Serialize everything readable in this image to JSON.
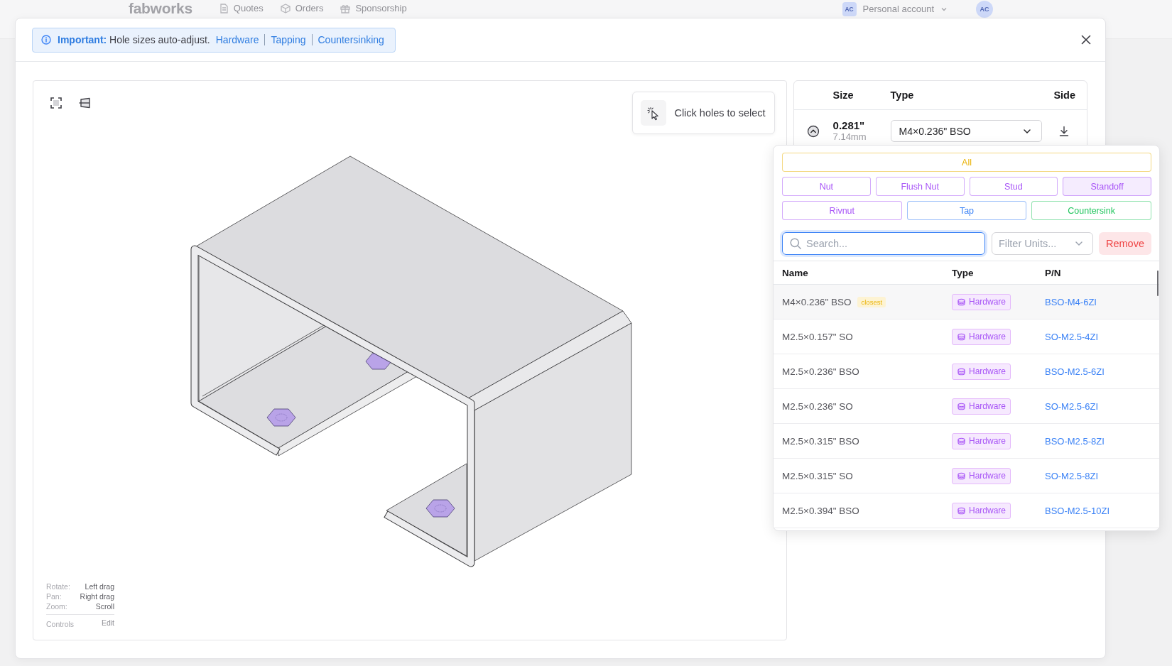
{
  "background_nav": {
    "logo": "fabworks",
    "links": [
      "Quotes",
      "Orders",
      "Sponsorship"
    ],
    "account_initials": "AC",
    "account": "Personal account",
    "avatar": "AC"
  },
  "notice": {
    "text": "**Important:** Hole sizes auto-adjust.",
    "links": [
      "Hardware",
      "Tapping",
      "Countersinking"
    ]
  },
  "viewer": {
    "hint": "Click holes to select",
    "controls": [
      {
        "action": "Rotate:",
        "input": "Left drag"
      },
      {
        "action": "Pan:",
        "input": "Right drag"
      },
      {
        "action": "Zoom:",
        "input": "Scroll"
      }
    ],
    "controls_label": "Controls",
    "edit_link": "Edit"
  },
  "holes_table": {
    "columns": [
      "Size",
      "Type",
      "Side"
    ],
    "rows": [
      {
        "size": "0.281\"",
        "size_mm": "7.14mm",
        "type": "M4×0.236\" BSO",
        "expanded": true
      }
    ]
  },
  "hardware_picker": {
    "filter_rows": [
      [
        {
          "label": "All",
          "color": "#eab308",
          "selected": false
        }
      ],
      [
        {
          "label": "Nut",
          "color": "#a855f7",
          "selected": false
        },
        {
          "label": "Flush Nut",
          "color": "#a855f7",
          "selected": false
        },
        {
          "label": "Stud",
          "color": "#a855f7",
          "selected": false
        },
        {
          "label": "Standoff",
          "color": "#a855f7",
          "selected": true
        }
      ],
      [
        {
          "label": "Rivnut",
          "color": "#a855f7",
          "selected": false
        },
        {
          "label": "Tap",
          "color": "#3b82f6",
          "selected": false
        },
        {
          "label": "Countersink",
          "color": "#22c55e",
          "selected": false
        }
      ]
    ],
    "search": {
      "placeholder": "Search..."
    },
    "unit_filter": {
      "placeholder": "Filter Units..."
    },
    "remove_button": "Remove",
    "columns": [
      "Name",
      "Type",
      "P/N"
    ],
    "rows": [
      {
        "name": "M4×0.236\" BSO",
        "tag": "closest",
        "type": "Hardware",
        "part_number": "BSO-M4-6ZI",
        "selected": true
      },
      {
        "name": "M2.5×0.157\" SO",
        "type": "Hardware",
        "part_number": "SO-M2.5-4ZI",
        "selected": false
      },
      {
        "name": "M2.5×0.236\" BSO",
        "type": "Hardware",
        "part_number": "BSO-M2.5-6ZI",
        "selected": false
      },
      {
        "name": "M2.5×0.236\" SO",
        "type": "Hardware",
        "part_number": "SO-M2.5-6ZI",
        "selected": false
      },
      {
        "name": "M2.5×0.315\" BSO",
        "type": "Hardware",
        "part_number": "BSO-M2.5-8ZI",
        "selected": false
      },
      {
        "name": "M2.5×0.315\" SO",
        "type": "Hardware",
        "part_number": "SO-M2.5-8ZI",
        "selected": false
      },
      {
        "name": "M2.5×0.394\" BSO",
        "type": "Hardware",
        "part_number": "BSO-M2.5-10ZI",
        "selected": false
      }
    ]
  }
}
